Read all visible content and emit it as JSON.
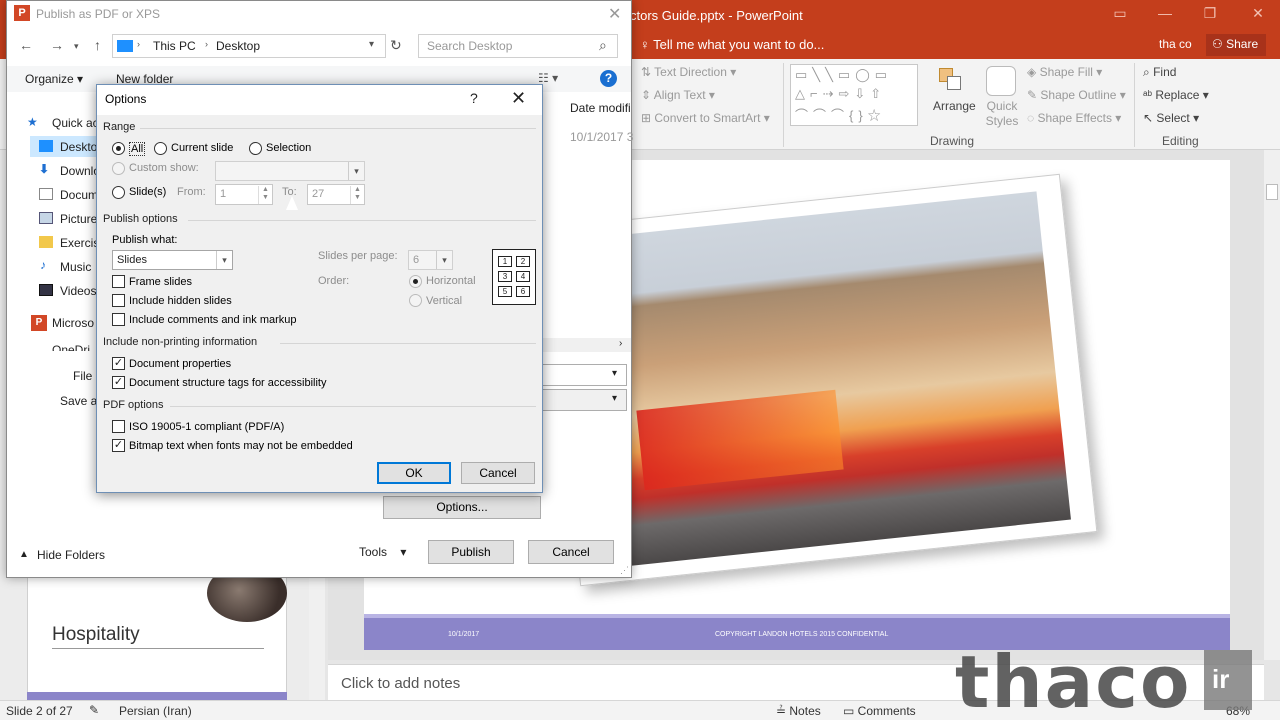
{
  "powerpoint": {
    "title": "ctors Guide.pptx - PowerPoint",
    "tell_me": "Tell me what you want to do...",
    "user": "tha co",
    "share": "Share",
    "ribbon": {
      "text_direction": "Text Direction",
      "align_text": "Align Text",
      "convert_smartart": "Convert to SmartArt",
      "arrange": "Arrange",
      "quick_styles": "Quick Styles",
      "shape_fill": "Shape Fill",
      "shape_outline": "Shape Outline",
      "shape_effects": "Shape Effects",
      "drawing_group": "Drawing",
      "find": "Find",
      "replace": "Replace",
      "select": "Select",
      "editing_group": "Editing"
    },
    "thumbnail_title": "Hospitality",
    "slide_footer_date": "10/1/2017",
    "slide_footer_copyright": "COPYRIGHT LANDON HOTELS 2015 CONFIDENTIAL",
    "notes_placeholder": "Click to add notes",
    "status": {
      "slide": "Slide 2 of 27",
      "language": "Persian (Iran)",
      "notes": "Notes",
      "comments": "Comments",
      "zoom": "68%"
    }
  },
  "watermark": {
    "text": "thaco",
    "suffix": "ir"
  },
  "publish_dialog": {
    "title": "Publish as PDF or XPS",
    "breadcrumb": [
      "This PC",
      "Desktop"
    ],
    "search_placeholder": "Search Desktop",
    "organize": "Organize",
    "new_folder": "New folder",
    "column_date": "Date modifi",
    "row_date": "10/1/2017 3",
    "nav_items": [
      "Quick ac",
      "Desktop",
      "Downlo",
      "Docum",
      "Picture",
      "Exercis",
      "Music",
      "Videos",
      "Microso",
      "OneDri"
    ],
    "file_name_label": "File n",
    "save_as_label": "Save as",
    "options_button": "Options...",
    "hide_folders": "Hide Folders",
    "tools": "Tools",
    "publish": "Publish",
    "cancel": "Cancel"
  },
  "options_dialog": {
    "title": "Options",
    "help": "?",
    "range": {
      "label": "Range",
      "all": "All",
      "current_slide": "Current slide",
      "selection": "Selection",
      "custom_show": "Custom show:",
      "slides": "Slide(s)",
      "from_label": "From:",
      "from_value": "1",
      "to_label": "To:",
      "to_value": "27"
    },
    "publish_options": {
      "label": "Publish options",
      "publish_what_label": "Publish what:",
      "publish_what_value": "Slides",
      "frame_slides": "Frame slides",
      "include_hidden": "Include hidden slides",
      "include_comments": "Include comments and ink markup",
      "slides_per_page_label": "Slides per page:",
      "slides_per_page_value": "6",
      "order_label": "Order:",
      "horizontal": "Horizontal",
      "vertical": "Vertical",
      "order_grid": [
        "1",
        "2",
        "3",
        "4",
        "5",
        "6"
      ]
    },
    "non_printing": {
      "label": "Include non-printing information",
      "document_properties": "Document properties",
      "structure_tags": "Document structure tags for accessibility"
    },
    "pdf_options": {
      "label": "PDF options",
      "iso": "ISO 19005-1 compliant (PDF/A)",
      "bitmap_text": "Bitmap text when fonts may not be embedded"
    },
    "ok": "OK",
    "cancel": "Cancel"
  },
  "colors": {
    "accent": "#c43e1c",
    "footer_band": "#8b85c9",
    "focus": "#0078d7"
  }
}
